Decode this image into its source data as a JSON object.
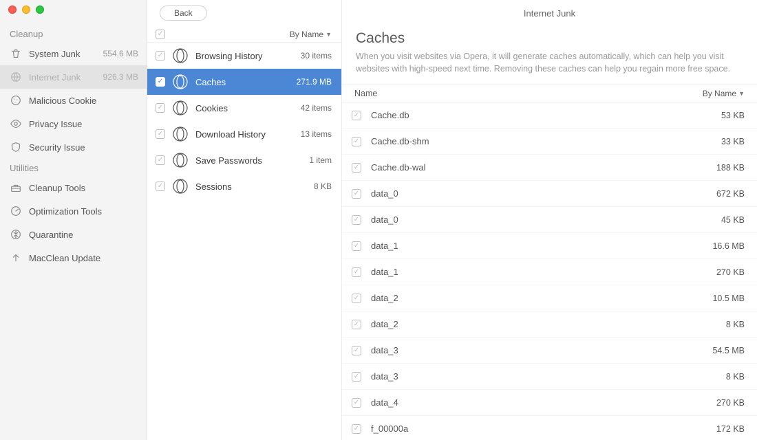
{
  "window": {
    "back_label": "Back",
    "title": "Internet Junk",
    "sort_label": "By Name"
  },
  "sidebar": {
    "sections": [
      {
        "title": "Cleanup",
        "items": [
          {
            "icon": "trash-icon",
            "label": "System Junk",
            "value": "554.6 MB",
            "selected": false
          },
          {
            "icon": "globe-icon",
            "label": "Internet Junk",
            "value": "926.3 MB",
            "selected": true
          },
          {
            "icon": "cookie-icon",
            "label": "Malicious Cookie",
            "value": "",
            "selected": false
          },
          {
            "icon": "eye-icon",
            "label": "Privacy Issue",
            "value": "",
            "selected": false
          },
          {
            "icon": "shield-icon",
            "label": "Security Issue",
            "value": "",
            "selected": false
          }
        ]
      },
      {
        "title": "Utilities",
        "items": [
          {
            "icon": "toolbox-icon",
            "label": "Cleanup Tools",
            "value": "",
            "selected": false
          },
          {
            "icon": "gauge-icon",
            "label": "Optimization Tools",
            "value": "",
            "selected": false
          },
          {
            "icon": "quarantine-icon",
            "label": "Quarantine",
            "value": "",
            "selected": false
          },
          {
            "icon": "update-icon",
            "label": "MacClean Update",
            "value": "",
            "selected": false
          }
        ]
      }
    ]
  },
  "categories": {
    "all_checked": true,
    "items": [
      {
        "label": "Browsing History",
        "value": "30 items",
        "checked": true,
        "selected": false
      },
      {
        "label": "Caches",
        "value": "271.9 MB",
        "checked": true,
        "selected": true
      },
      {
        "label": "Cookies",
        "value": "42 items",
        "checked": true,
        "selected": false
      },
      {
        "label": "Download History",
        "value": "13 items",
        "checked": true,
        "selected": false
      },
      {
        "label": "Save Passwords",
        "value": "1 item",
        "checked": true,
        "selected": false
      },
      {
        "label": "Sessions",
        "value": "8 KB",
        "checked": true,
        "selected": false
      }
    ]
  },
  "detail": {
    "heading": "Caches",
    "description": "When you visit websites via Opera, it will generate caches automatically, which can help you visit websites with high-speed next time. Removing these caches can help you regain more free space.",
    "col_name": "Name",
    "col_sort": "By Name",
    "files": [
      {
        "name": "Cache.db",
        "size": "53 KB",
        "checked": true
      },
      {
        "name": "Cache.db-shm",
        "size": "33 KB",
        "checked": true
      },
      {
        "name": "Cache.db-wal",
        "size": "188 KB",
        "checked": true
      },
      {
        "name": "data_0",
        "size": "672 KB",
        "checked": true
      },
      {
        "name": "data_0",
        "size": "45 KB",
        "checked": true
      },
      {
        "name": "data_1",
        "size": "16.6 MB",
        "checked": true
      },
      {
        "name": "data_1",
        "size": "270 KB",
        "checked": true
      },
      {
        "name": "data_2",
        "size": "10.5 MB",
        "checked": true
      },
      {
        "name": "data_2",
        "size": "8 KB",
        "checked": true
      },
      {
        "name": "data_3",
        "size": "54.5 MB",
        "checked": true
      },
      {
        "name": "data_3",
        "size": "8 KB",
        "checked": true
      },
      {
        "name": "data_4",
        "size": "270 KB",
        "checked": true
      },
      {
        "name": "f_00000a",
        "size": "172 KB",
        "checked": true
      }
    ]
  }
}
